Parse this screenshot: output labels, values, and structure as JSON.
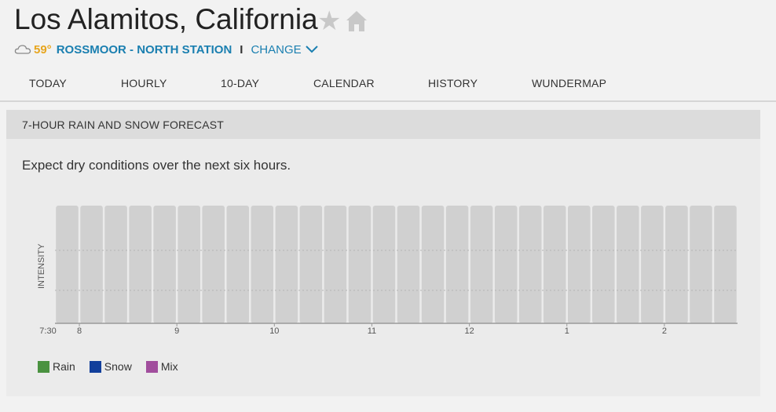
{
  "header": {
    "city": "Los Alamitos, California",
    "temperature": "59°",
    "station": "ROSSMOOR - NORTH STATION",
    "separator": "I",
    "change_label": "CHANGE",
    "icons": {
      "star": "star-icon",
      "home": "home-icon",
      "weather": "cloud-icon",
      "change": "chevron-down-icon"
    },
    "colors": {
      "temperature": "#e7a51d",
      "link": "#1a7fb0"
    }
  },
  "nav": {
    "tabs": [
      {
        "label": "TODAY"
      },
      {
        "label": "HOURLY"
      },
      {
        "label": "10-DAY"
      },
      {
        "label": "CALENDAR"
      },
      {
        "label": "HISTORY"
      },
      {
        "label": "WUNDERMAP"
      }
    ]
  },
  "panel": {
    "title": "7-HOUR RAIN AND SNOW FORECAST",
    "message": "Expect dry conditions over the next six hours."
  },
  "chart_data": {
    "type": "bar",
    "title": "",
    "ylabel": "INTENSITY",
    "xlabel": "",
    "x_tick_labels": [
      "7:30",
      "8",
      "9",
      "10",
      "11",
      "12",
      "1",
      "2"
    ],
    "bar_count": 28,
    "values": [
      1,
      1,
      1,
      1,
      1,
      1,
      1,
      1,
      1,
      1,
      1,
      1,
      1,
      1,
      1,
      1,
      1,
      1,
      1,
      1,
      1,
      1,
      1,
      1,
      1,
      1,
      1,
      1
    ],
    "value_meaning": "full-height gray bars, no precipitation shown",
    "ylim": [
      0,
      1
    ],
    "grid": true,
    "bar_color": "#d0d0d0",
    "legend": [
      {
        "name": "Rain",
        "color": "#4a9240"
      },
      {
        "name": "Snow",
        "color": "#123f9b"
      },
      {
        "name": "Mix",
        "color": "#a14e9d"
      }
    ],
    "legend_position": "bottom-left"
  }
}
